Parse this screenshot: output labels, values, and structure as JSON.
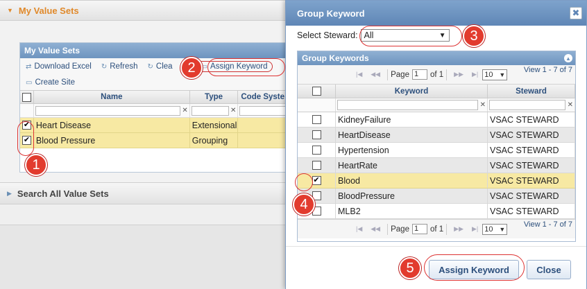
{
  "background": {
    "accordion_top": {
      "label": "My Value Sets"
    },
    "value_sets_panel": {
      "title": "My Value Sets",
      "toolbar": {
        "download_excel": "Download Excel",
        "refresh": "Refresh",
        "clear": "Clea",
        "assign_keyword": "Assign Keyword",
        "create_site": "Create Site"
      },
      "columns": [
        "Name",
        "Type",
        "Code Syste"
      ],
      "rows": [
        {
          "checked": true,
          "name": "Heart Disease",
          "type": "Extensional"
        },
        {
          "checked": true,
          "name": "Blood Pressure",
          "type": "Grouping"
        }
      ]
    },
    "accordion_bottom": {
      "label": "Search All Value Sets"
    }
  },
  "dialog": {
    "title": "Group Keyword",
    "close_icon": "✖",
    "steward_label": "Select Steward:",
    "steward_value": "All",
    "grid": {
      "title": "Group Keywords",
      "pager": {
        "page_label": "Page",
        "page": "1",
        "of_label": "of 1",
        "page_size": "10",
        "view": "View 1 - 7 of 7"
      },
      "columns": {
        "keyword": "Keyword",
        "steward": "Steward"
      },
      "rows": [
        {
          "checked": false,
          "keyword": "KidneyFailure",
          "steward": "VSAC STEWARD"
        },
        {
          "checked": false,
          "keyword": "HeartDisease",
          "steward": "VSAC STEWARD"
        },
        {
          "checked": false,
          "keyword": "Hypertension",
          "steward": "VSAC STEWARD"
        },
        {
          "checked": false,
          "keyword": "HeartRate",
          "steward": "VSAC STEWARD"
        },
        {
          "checked": true,
          "keyword": "Blood",
          "steward": "VSAC STEWARD"
        },
        {
          "checked": false,
          "keyword": "BloodPressure",
          "steward": "VSAC STEWARD"
        },
        {
          "checked": false,
          "keyword": "MLB2",
          "steward": "VSAC STEWARD"
        }
      ]
    },
    "buttons": {
      "assign": "Assign Keyword",
      "close": "Close"
    }
  },
  "annotations": [
    "1",
    "2",
    "3",
    "4",
    "5"
  ]
}
